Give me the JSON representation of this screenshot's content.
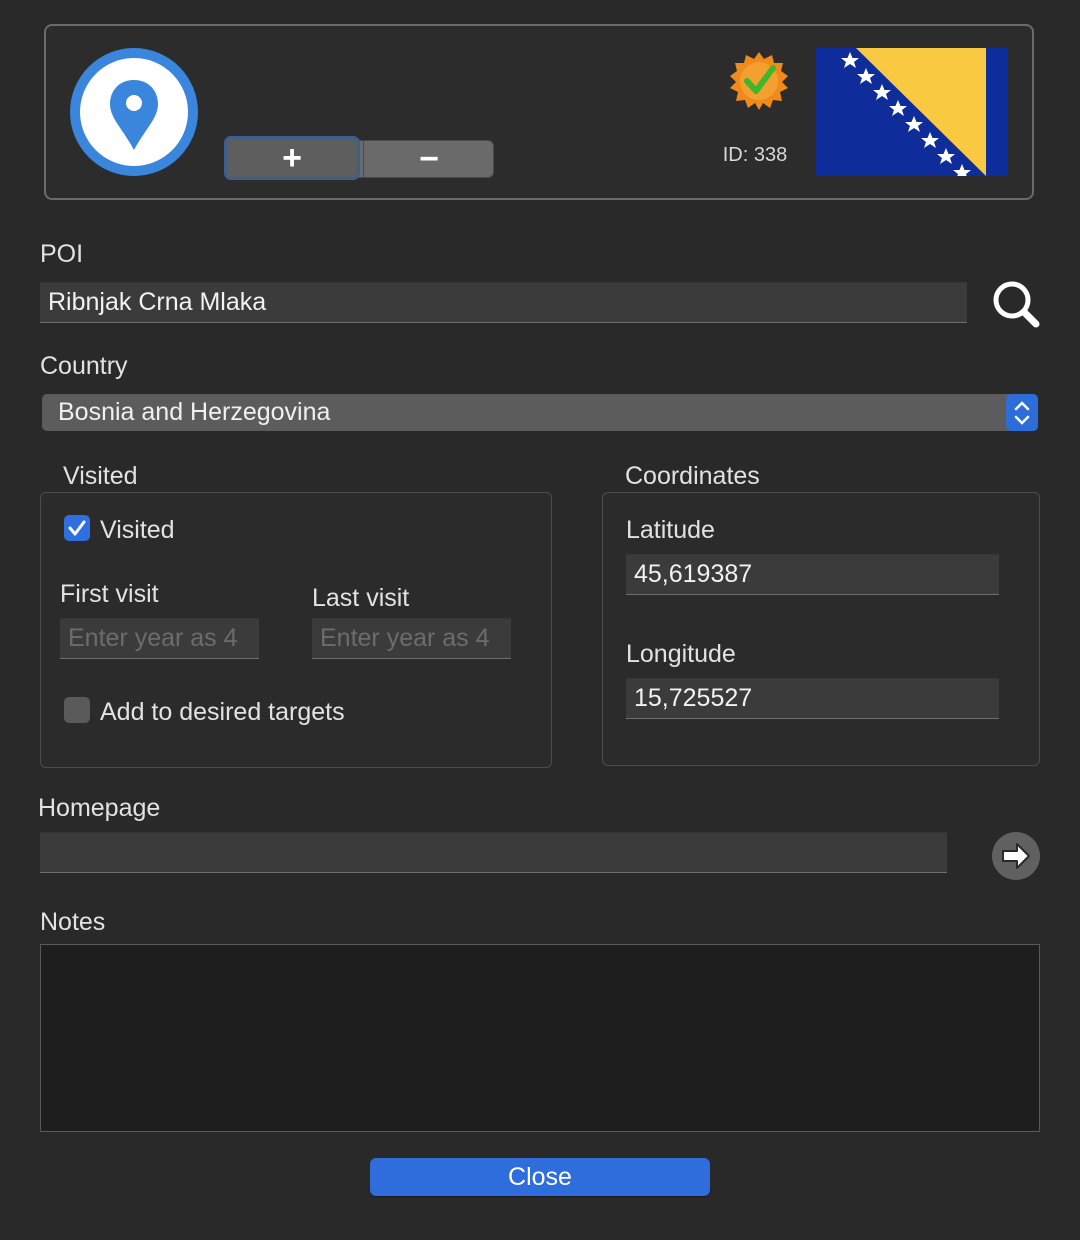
{
  "header": {
    "add_label": "+",
    "remove_label": "−",
    "id_text": "ID: 338",
    "badge_icon": "verified-badge-icon",
    "poi_icon": "map-pin-icon",
    "flag_icon": "bosnia-herzegovina-flag-icon",
    "colors": {
      "poi_blue": "#3a86dd",
      "flag_blue": "#0f2d9a",
      "flag_yellow": "#f9c941",
      "badge_orange": "#f08a1c",
      "badge_check": "#3fb72b"
    }
  },
  "poi": {
    "label": "POI",
    "value": "Ribnjak Crna Mlaka",
    "search_icon": "search-icon"
  },
  "country": {
    "label": "Country",
    "selected": "Bosnia and Herzegovina"
  },
  "visited": {
    "group_title": "Visited",
    "checkbox_label": "Visited",
    "checked": true,
    "first_visit_label": "First visit",
    "first_visit_placeholder": "Enter year as 4",
    "last_visit_label": "Last visit",
    "last_visit_placeholder": "Enter year as 4",
    "desired_label": "Add to desired targets",
    "desired_checked": false
  },
  "coordinates": {
    "group_title": "Coordinates",
    "latitude_label": "Latitude",
    "latitude_value": "45,619387",
    "longitude_label": "Longitude",
    "longitude_value": "15,725527"
  },
  "homepage": {
    "label": "Homepage",
    "value": "",
    "go_icon": "arrow-right-icon"
  },
  "notes": {
    "label": "Notes",
    "value": ""
  },
  "footer": {
    "close_label": "Close",
    "accent": "#2f6cdc"
  }
}
